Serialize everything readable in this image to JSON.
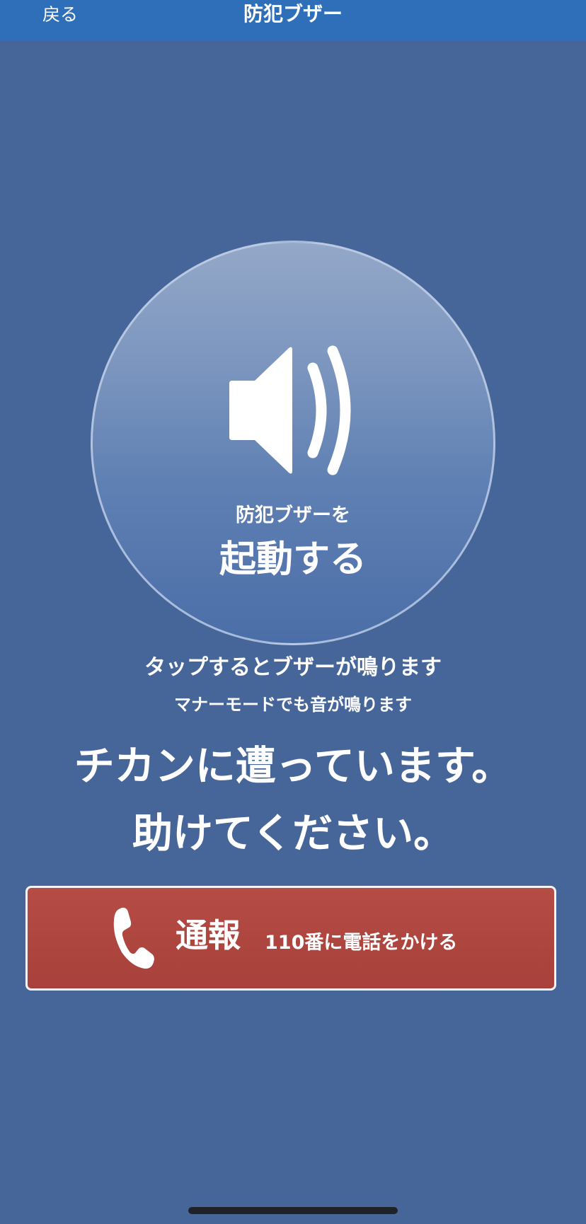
{
  "navbar": {
    "back_label": "戻る",
    "title": "防犯ブザー"
  },
  "buzzer": {
    "subtitle": "防犯ブザーを",
    "label": "起動する",
    "icon": "speaker-icon"
  },
  "hints": {
    "tap": "タップするとブザーが鳴ります",
    "silent": "マナーモードでも音が鳴ります"
  },
  "message": {
    "line1": "チカンに遭っています。",
    "line2": "助けてください。"
  },
  "call": {
    "label": "通報",
    "description": "110番に電話をかける",
    "icon": "phone-icon"
  },
  "colors": {
    "navbar": "#2f6fba",
    "background": "#46669a",
    "call_button": "#a8413b"
  }
}
